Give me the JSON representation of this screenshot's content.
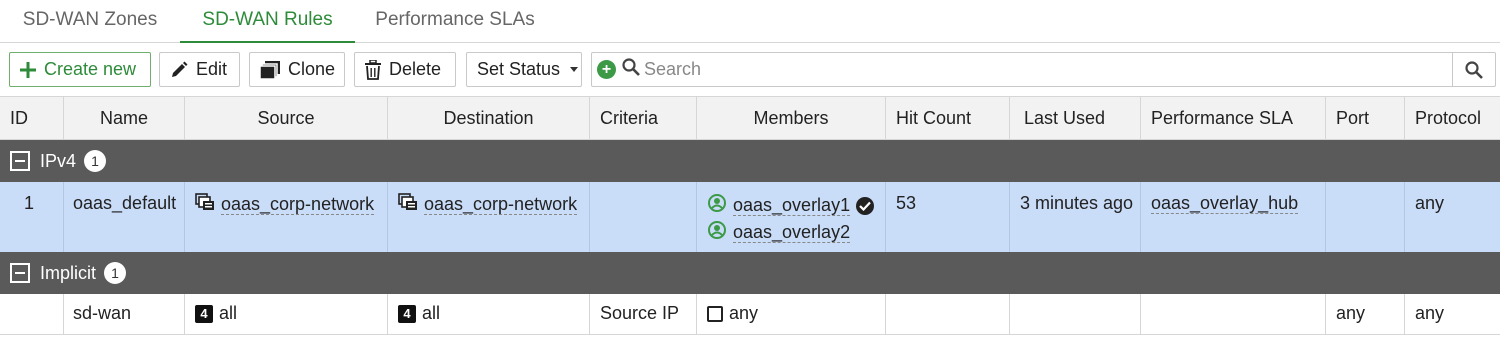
{
  "tabs": [
    {
      "label": "SD-WAN Zones",
      "active": false
    },
    {
      "label": "SD-WAN Rules",
      "active": true
    },
    {
      "label": "Performance SLAs",
      "active": false
    }
  ],
  "toolbar": {
    "create_label": "Create new",
    "edit_label": "Edit",
    "clone_label": "Clone",
    "delete_label": "Delete",
    "set_status_label": "Set Status",
    "search_placeholder": "Search",
    "search_value": ""
  },
  "table": {
    "columns": [
      "ID",
      "Name",
      "Source",
      "Destination",
      "Criteria",
      "Members",
      "Hit Count",
      "Last Used",
      "Performance SLA",
      "Port",
      "Protocol"
    ],
    "groups": [
      {
        "label": "IPv4",
        "count": "1",
        "rows": [
          {
            "id": "1",
            "name": "oaas_default",
            "source": "oaas_corp-network",
            "destination": "oaas_corp-network",
            "criteria": "",
            "members": [
              "oaas_overlay1",
              "oaas_overlay2"
            ],
            "hit_count": "53",
            "last_used": "3 minutes ago",
            "performance_sla": "oaas_overlay_hub",
            "port": "",
            "protocol": "any"
          }
        ]
      },
      {
        "label": "Implicit",
        "count": "1",
        "rows": [
          {
            "id": "",
            "name": "sd-wan",
            "source": "all",
            "destination": "all",
            "criteria": "Source IP",
            "members": [
              "any"
            ],
            "hit_count": "",
            "last_used": "",
            "performance_sla": "",
            "port": "any",
            "protocol": "any"
          }
        ]
      }
    ]
  },
  "icons": {
    "source_icon_ipv4": "address-group-icon",
    "source_icon_implicit": "ipv4-all-icon",
    "member_icon": "sdwan-member-icon",
    "member_selected": "check-circle-icon",
    "member_implicit": "checkbox-icon"
  },
  "colors": {
    "accent": "#2e8b3a",
    "selected_row": "#c9dcf8",
    "group_header": "#5a5a5a",
    "header_bg": "#f2f2f2"
  }
}
